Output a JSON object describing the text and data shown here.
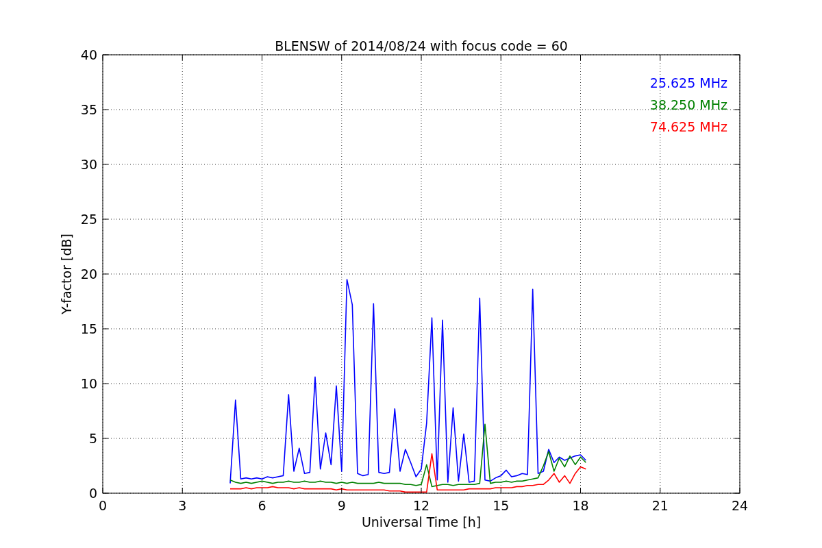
{
  "chart_data": {
    "type": "line",
    "grid": true,
    "title": "BLENSW of 2014/08/24 with focus code = 60",
    "xlabel": "Universal Time [h]",
    "ylabel": "Y-factor [dB]",
    "x": [
      4.8,
      5.0,
      5.2,
      5.4,
      5.6,
      5.8,
      6.0,
      6.2,
      6.4,
      6.6,
      6.8,
      7.0,
      7.2,
      7.4,
      7.6,
      7.8,
      8.0,
      8.2,
      8.4,
      8.6,
      8.8,
      9.0,
      9.2,
      9.4,
      9.6,
      9.8,
      10.0,
      10.2,
      10.4,
      10.6,
      10.8,
      11.0,
      11.2,
      11.4,
      11.6,
      11.8,
      12.0,
      12.2,
      12.4,
      12.6,
      12.8,
      13.0,
      13.2,
      13.4,
      13.6,
      13.8,
      14.0,
      14.2,
      14.4,
      14.6,
      14.8,
      15.0,
      15.2,
      15.4,
      15.6,
      15.8,
      16.0,
      16.2,
      16.4,
      16.6,
      16.8,
      17.0,
      17.2,
      17.4,
      17.6,
      17.8,
      18.0,
      18.2
    ],
    "series": [
      {
        "name": "25.625 MHz",
        "color": "#0000ff",
        "values": [
          0.9,
          8.5,
          1.3,
          1.4,
          1.3,
          1.4,
          1.3,
          1.5,
          1.4,
          1.5,
          1.6,
          9.0,
          2.0,
          4.1,
          1.8,
          1.9,
          10.6,
          2.2,
          5.5,
          2.6,
          9.8,
          2.0,
          19.5,
          17.2,
          1.8,
          1.6,
          1.7,
          17.3,
          1.9,
          1.8,
          1.9,
          7.7,
          2.0,
          4.0,
          2.8,
          1.5,
          2.2,
          6.4,
          16.0,
          1.2,
          15.8,
          1.0,
          7.8,
          1.1,
          5.4,
          1.0,
          1.1,
          17.8,
          1.2,
          1.1,
          1.4,
          1.6,
          2.1,
          1.5,
          1.6,
          1.8,
          1.7,
          18.6,
          1.8,
          2.0,
          4.0,
          2.8,
          3.3,
          3.0,
          3.2,
          3.4,
          3.5,
          3.0
        ]
      },
      {
        "name": "38.250 MHz",
        "color": "#008000",
        "values": [
          1.2,
          1.0,
          0.9,
          1.0,
          0.9,
          1.0,
          1.1,
          1.0,
          0.9,
          1.0,
          1.0,
          1.1,
          1.0,
          1.0,
          1.1,
          1.0,
          1.0,
          1.1,
          1.0,
          1.0,
          0.9,
          1.0,
          0.9,
          1.0,
          0.9,
          0.9,
          0.9,
          0.9,
          1.0,
          0.9,
          0.9,
          0.9,
          0.9,
          0.8,
          0.8,
          0.7,
          0.8,
          2.6,
          0.6,
          0.7,
          0.8,
          0.8,
          0.7,
          0.8,
          0.8,
          0.8,
          0.8,
          0.9,
          6.3,
          0.9,
          1.0,
          1.0,
          1.1,
          1.0,
          1.1,
          1.1,
          1.2,
          1.3,
          1.4,
          2.5,
          3.8,
          2.0,
          3.2,
          2.4,
          3.4,
          2.6,
          3.3,
          2.8
        ]
      },
      {
        "name": "74.625 MHz",
        "color": "#ff0000",
        "values": [
          0.4,
          0.4,
          0.4,
          0.5,
          0.4,
          0.5,
          0.5,
          0.5,
          0.6,
          0.5,
          0.5,
          0.5,
          0.4,
          0.5,
          0.4,
          0.4,
          0.4,
          0.4,
          0.4,
          0.4,
          0.3,
          0.4,
          0.3,
          0.3,
          0.3,
          0.3,
          0.3,
          0.3,
          0.3,
          0.3,
          0.2,
          0.2,
          0.2,
          0.1,
          0.1,
          0.1,
          0.1,
          0.1,
          3.6,
          0.3,
          0.3,
          0.3,
          0.3,
          0.3,
          0.3,
          0.4,
          0.4,
          0.4,
          0.4,
          0.4,
          0.5,
          0.5,
          0.5,
          0.5,
          0.6,
          0.6,
          0.7,
          0.7,
          0.8,
          0.8,
          1.2,
          1.8,
          1.0,
          1.6,
          0.9,
          1.8,
          2.4,
          2.2
        ]
      }
    ],
    "xlim": [
      0,
      24
    ],
    "ylim": [
      0,
      40
    ],
    "xticks": [
      0,
      3,
      6,
      9,
      12,
      15,
      18,
      21,
      24
    ],
    "yticks": [
      0,
      5,
      10,
      15,
      20,
      25,
      30,
      35,
      40
    ]
  }
}
